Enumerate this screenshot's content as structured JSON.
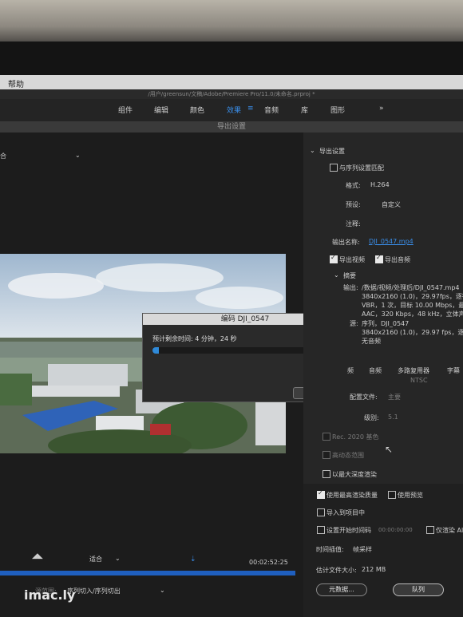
{
  "menu": {
    "help": "帮助"
  },
  "path": "/用户/greensun/文稿/Adobe/Premiere Pro/11.0/未命名.prproj *",
  "tabs": [
    {
      "label": "组件"
    },
    {
      "label": "编辑"
    },
    {
      "label": "颜色"
    },
    {
      "label": "效果"
    },
    {
      "label": "音频"
    },
    {
      "label": "库"
    },
    {
      "label": "图形"
    },
    {
      "label": "»"
    }
  ],
  "dialog_title": "导出设置",
  "left": {
    "source_label": "合"
  },
  "export": {
    "section": "导出设置",
    "match_sequence": "与序列设置匹配",
    "format_label": "格式:",
    "format_value": "H.264",
    "preset_label": "预设:",
    "preset_value": "自定义",
    "comment_label": "注释:",
    "output_name_label": "输出名称:",
    "output_name_value": "DJI_0547.mp4",
    "export_video": "导出视频",
    "export_audio": "导出音频",
    "summary": "摘要",
    "output_label": "输出:",
    "output_line1": "/数据/视频/处理后/DJI_0547.mp4",
    "output_line2": "3840x2160 (1.0)，29.97fps，逐行，0",
    "output_line3": "VBR，1 次，目标 10.00 Mbps，最大 12",
    "output_line4": "AAC，320 Kbps，48 kHz，立体声",
    "source_label": "源:",
    "source_line1": "序列，DJI_0547",
    "source_line2": "3840x2160 (1.0)，29.97 fps，逐行，",
    "source_line3": "无音频"
  },
  "subtabs": [
    {
      "label": "频"
    },
    {
      "label": "音频"
    },
    {
      "label": "多路复用器"
    },
    {
      "label": "字幕"
    }
  ],
  "video_settings": {
    "partial_hidden": "NTSC",
    "profile_label": "配置文件:",
    "profile_value": "主要",
    "level_label": "级别:",
    "level_value": "5.1",
    "rec2020": "Rec. 2020 基色",
    "hdr": "高动态范围",
    "max_depth": "以最大深度渲染"
  },
  "bottom_options": {
    "max_quality": "使用最高渲染质量",
    "use_preview": "使用预览",
    "import_project": "导入到项目中",
    "set_start_tc": "设置开始时间码",
    "start_tc_value": "00:00:00:00",
    "render_alpha_only": "仅渲染 Al",
    "interp_label": "时间插值:",
    "interp_value": "帧采样",
    "filesize_label": "估计文件大小:",
    "filesize_value": "212 MB",
    "metadata_button": "元数据...",
    "queue_button": "队列"
  },
  "progress": {
    "title": "编码 DJI_0547",
    "remaining": "预计剩余时间: 4 分钟，24 秒",
    "percent_label": "3%",
    "percent_value": 0.03,
    "cancel": "取消"
  },
  "playback": {
    "fit": "适合",
    "timecode": "00:02:52:25",
    "range_label": "源范围:",
    "range_value": "序列切入/序列切出"
  },
  "watermark": "imac.ly",
  "colors": {
    "accent": "#3a8eea",
    "progress": "#2f8ad9"
  }
}
